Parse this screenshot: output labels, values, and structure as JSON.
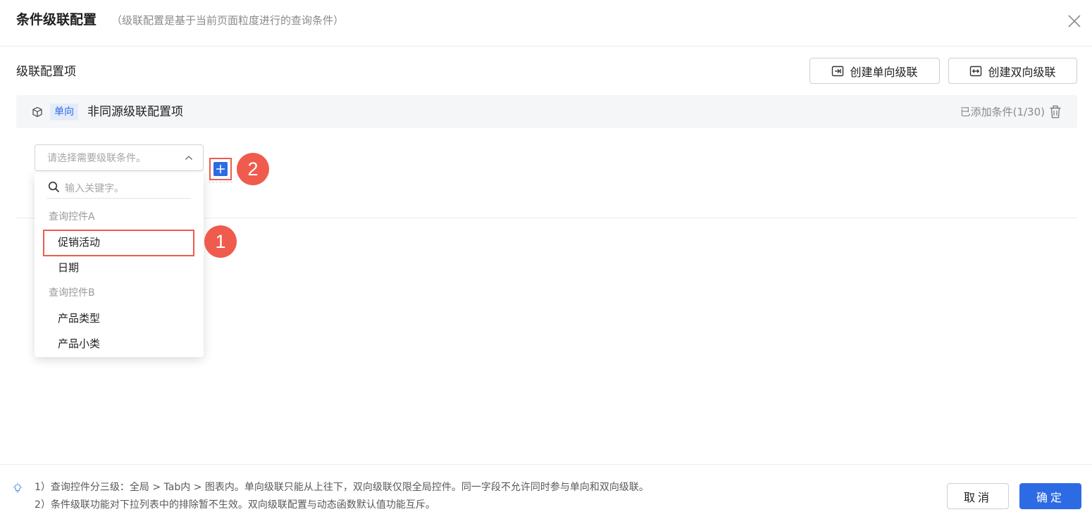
{
  "dialog": {
    "title": "条件级联配置",
    "subtitle": "（级联配置是基于当前页面粒度进行的查询条件）"
  },
  "section": {
    "label": "级联配置项",
    "btn_single": "创建单向级联",
    "btn_double": "创建双向级联"
  },
  "cascade_item": {
    "tag": "单向",
    "name": "非同源级联配置项",
    "count": "已添加条件(1/30)"
  },
  "condition_select": {
    "placeholder": "请选择需要级联条件。"
  },
  "dropdown": {
    "search_placeholder": "输入关键字。",
    "groups": [
      {
        "label": "查询控件A",
        "items": [
          "促销活动",
          "日期"
        ]
      },
      {
        "label": "查询控件B",
        "items": [
          "产品类型",
          "产品小类"
        ]
      }
    ]
  },
  "annotations": {
    "badge_1": "1",
    "badge_2": "2"
  },
  "footer": {
    "note_1": "1）查询控件分三级：全局 > Tab内 > 图表内。单向级联只能从上往下，双向级联仅限全局控件。同一字段不允许同时参与单向和双向级联。",
    "note_2": "2）条件级联功能对下拉列表中的排除暂不生效。双向级联配置与动态函数默认值功能互斥。",
    "cancel": "取消",
    "confirm": "确定"
  },
  "colors": {
    "accent": "#2d6be4",
    "annotation_red": "#ef5b4c",
    "tag_bg": "#e4ecfb"
  },
  "icons": {
    "close": "close-icon",
    "single_arrow": "arrow-right-to-bar-icon",
    "double_arrow": "double-arrow-icon",
    "cube": "cube-icon",
    "trash": "trash-icon",
    "chevron": "chevron-up-icon",
    "add": "plus-icon",
    "search": "search-icon",
    "bulb": "lightbulb-icon"
  }
}
